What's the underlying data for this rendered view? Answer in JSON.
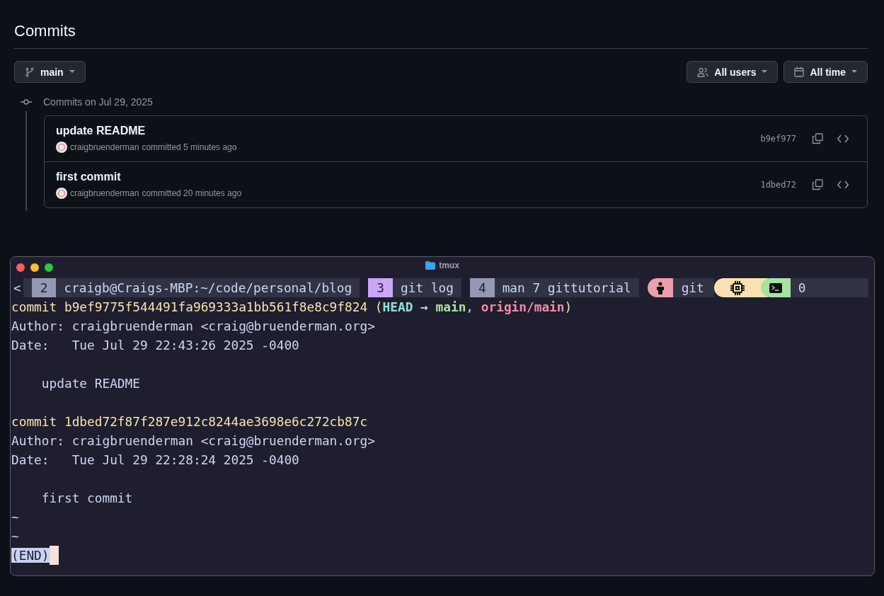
{
  "page_title": "Commits",
  "branch": {
    "label": "main"
  },
  "filters": [
    {
      "kind": "users",
      "label": "All users"
    },
    {
      "kind": "time",
      "label": "All time"
    }
  ],
  "group": {
    "heading": "Commits on Jul 29, 2025",
    "commits": [
      {
        "message": "update README",
        "author": "craigbruenderman",
        "meta": "committed 5 minutes ago",
        "sha": "b9ef977"
      },
      {
        "message": "first commit",
        "author": "craigbruenderman",
        "meta": "committed 20 minutes ago",
        "sha": "1dbed72"
      }
    ]
  },
  "terminal": {
    "title": "tmux",
    "status": {
      "left": "<",
      "windows": [
        {
          "index": "2",
          "title": "craigb@Craigs-MBP:~/code/personal/blog",
          "selected": false
        },
        {
          "index": "3",
          "title": "git log",
          "selected": true
        },
        {
          "index": "4",
          "title": "man 7 gittutorial",
          "selected": false
        }
      ],
      "session": "git",
      "count": "0"
    },
    "lines": [
      {
        "kind": "text",
        "segments": [
          {
            "kind": "hash",
            "text": "commit b9ef9775f544491fa969333a1bb561f8e8c9f824"
          },
          {
            "kind": "hash",
            "text": " ("
          },
          {
            "kind": "head",
            "text": "HEAD → "
          },
          {
            "kind": "branch",
            "text": "main"
          },
          {
            "kind": "plain",
            "text": ", "
          },
          {
            "kind": "remote",
            "text": "origin/main"
          },
          {
            "kind": "hash",
            "text": ")"
          }
        ]
      },
      {
        "kind": "text",
        "segments": [
          {
            "kind": "plain",
            "text": "Author: craigbruenderman <craig@bruenderman.org>"
          }
        ]
      },
      {
        "kind": "text",
        "segments": [
          {
            "kind": "plain",
            "text": "Date:   Tue Jul 29 22:43:26 2025 -0400"
          }
        ]
      },
      {
        "kind": "blank"
      },
      {
        "kind": "text",
        "segments": [
          {
            "kind": "plain",
            "text": "    update README"
          }
        ]
      },
      {
        "kind": "blank"
      },
      {
        "kind": "text",
        "segments": [
          {
            "kind": "hash",
            "text": "commit 1dbed72f87f287e912c8244ae3698e6c272cb87c"
          }
        ]
      },
      {
        "kind": "text",
        "segments": [
          {
            "kind": "plain",
            "text": "Author: craigbruenderman <craig@bruenderman.org>"
          }
        ]
      },
      {
        "kind": "text",
        "segments": [
          {
            "kind": "plain",
            "text": "Date:   Tue Jul 29 22:28:24 2025 -0400"
          }
        ]
      },
      {
        "kind": "blank"
      },
      {
        "kind": "text",
        "segments": [
          {
            "kind": "plain",
            "text": "    first commit"
          }
        ]
      },
      {
        "kind": "tilde",
        "text": "~"
      },
      {
        "kind": "tilde",
        "text": "~"
      },
      {
        "kind": "end",
        "text": "(END)"
      }
    ]
  }
}
